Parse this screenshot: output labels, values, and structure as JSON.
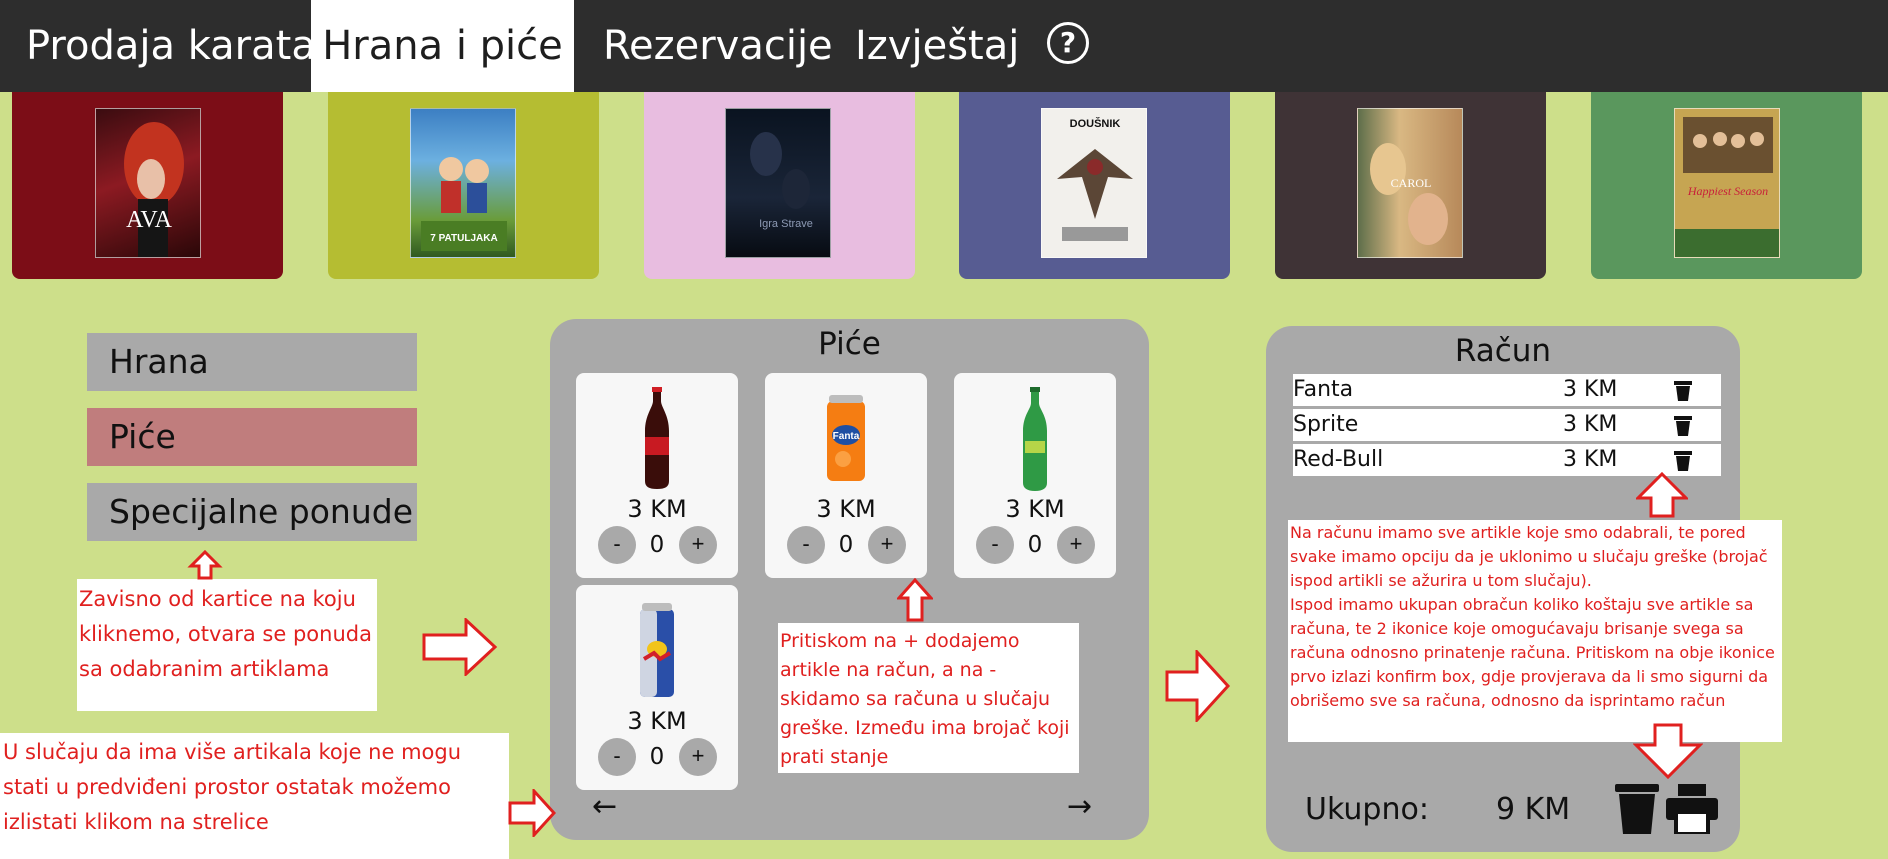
{
  "nav": {
    "tabs": [
      {
        "label": "Prodaja karata"
      },
      {
        "label": "Hrana i piće"
      },
      {
        "label": "Rezervacije"
      },
      {
        "label": "Izvještaj"
      }
    ],
    "help_icon": "question-circle-icon"
  },
  "movies": [
    {
      "poster_text": "AVA",
      "color": "#7c0d17"
    },
    {
      "poster_text": "7 PATULJAKA",
      "color": "#b5bd32"
    },
    {
      "poster_text": "Igra Strave",
      "color": "#e8bde0"
    },
    {
      "poster_text": "DOUŠNIK",
      "color": "#575c92"
    },
    {
      "poster_text": "CAROL",
      "color": "#3f3336"
    },
    {
      "poster_text": "Happiest Season",
      "color": "#5a975d"
    }
  ],
  "categories": [
    {
      "label": "Hrana"
    },
    {
      "label": "Piće"
    },
    {
      "label": "Specijalne ponude"
    }
  ],
  "drinks_panel": {
    "title": "Piće",
    "products": [
      {
        "product": "coca-cola",
        "price": "3 KM",
        "count": "0"
      },
      {
        "product": "fanta",
        "price": "3 KM",
        "count": "0"
      },
      {
        "product": "sprite",
        "price": "3 KM",
        "count": "0"
      },
      {
        "product": "red-bull",
        "price": "3 KM",
        "count": "0"
      }
    ],
    "minus_label": "-",
    "plus_label": "+",
    "prev_arrow": "←",
    "next_arrow": "→"
  },
  "bill": {
    "title": "Račun",
    "items": [
      {
        "name": "Fanta",
        "price": "3 KM"
      },
      {
        "name": "Sprite",
        "price": "3 KM"
      },
      {
        "name": "Red-Bull",
        "price": "3 KM"
      }
    ],
    "total_label": "Ukupno:",
    "total_value": "9 KM"
  },
  "annotations": {
    "categories_note": "Zavisno od kartice na koju kliknemo, otvara se ponuda sa odabranim artiklama",
    "arrows_note": "U slučaju da ima više artikala koje ne mogu stati u predviđeni prostor ostatak možemo izlistati klikom na strelice",
    "stepper_note": "Pritiskom na + dodajemo artikle na račun, a na - skidamo sa računa u slučaju greške. Između ima brojač koji prati stanje",
    "bill_note": "Na računu imamo sve artikle koje smo odabrali, te pored svake imamo opciju da je uklonimo u slučaju greške (brojač ispod artikli se ažurira u tom slučaju).\nIspod imamo ukupan obračun koliko koštaju sve artikle sa računa, te 2 ikonice koje omogućavaju brisanje svega sa računa odnosno prinatenje računa. Pritiskom na obje ikonice prvo izlazi konfirm box, gdje provjerava da li smo sigurni da obrišemo sve sa računa, odnosno da isprintamo račun"
  },
  "colors": {
    "background": "#cddf8a",
    "topbar": "#2d2d2d",
    "panel": "#a9a9a9",
    "active_category": "#c07d7d",
    "annotation_text": "#e0201f"
  }
}
